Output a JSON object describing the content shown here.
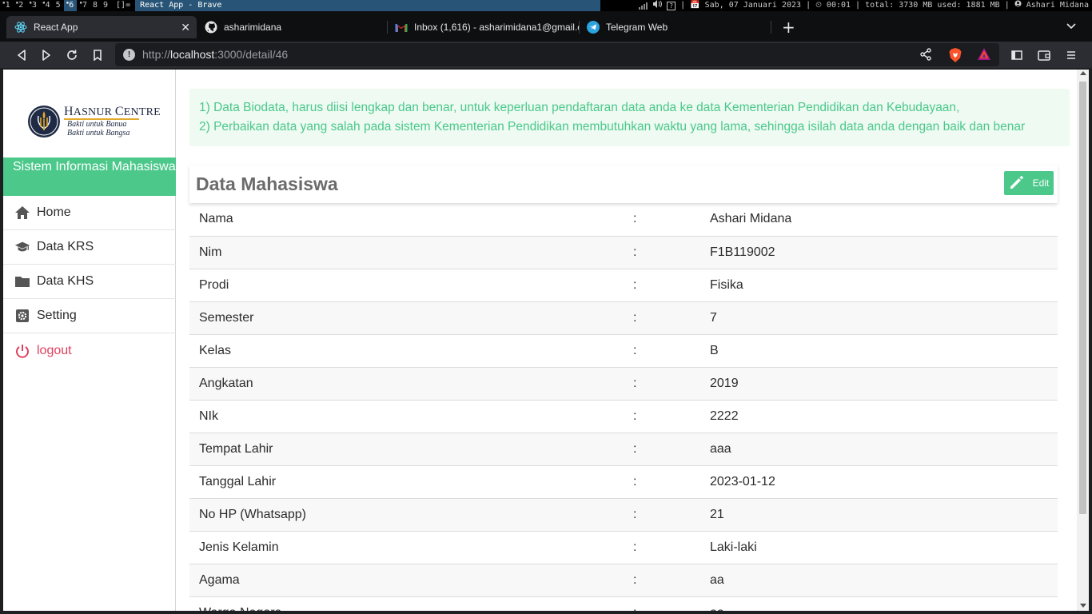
{
  "system_bar": {
    "workspaces": [
      {
        "num": "1",
        "sup": "▪"
      },
      {
        "num": "2",
        "sup": "▪"
      },
      {
        "num": "3",
        "sup": "▪"
      },
      {
        "num": "4",
        "sup": "▪"
      },
      {
        "num": "5",
        "sup": ""
      },
      {
        "num": "6",
        "sup": "▪"
      },
      {
        "num": "7",
        "sup": "▪"
      },
      {
        "num": "8",
        "sup": ""
      },
      {
        "num": "9",
        "sup": ""
      }
    ],
    "active_workspace": "6",
    "layout": "[]=",
    "window_title": "React App - Brave",
    "status": "| 📅 Sab, 07 Januari 2023 | ⏲ 00:01 | total: 3730 MB used: 1881 MB |",
    "user": "Ashari Midana"
  },
  "browser": {
    "tabs": [
      {
        "label": "React App",
        "icon": "react-icon",
        "active": true
      },
      {
        "label": "asharimidana",
        "icon": "github-icon",
        "active": false
      },
      {
        "label": "Inbox (1,616) - asharimidana1@gmail.com",
        "icon": "gmail-icon",
        "active": false
      },
      {
        "label": "Telegram Web",
        "icon": "telegram-icon",
        "active": false
      }
    ],
    "url_scheme": "http://",
    "url_host": "localhost",
    "url_path": ":3000/detail/46",
    "colors": {
      "tab_active": "#2b2d33",
      "tabbar": "#0e0f11"
    }
  },
  "sidebar": {
    "logo": {
      "brand_first": "H",
      "brand_rest": "ASNUR ",
      "brand_first2": "C",
      "brand_rest2": "ENTRE",
      "tag1": "Bakti untuk Banua",
      "tag2": "Bakti untuk Bangsa"
    },
    "header": "Sistem Informasi Mahasiswa",
    "items": [
      {
        "label": "Home",
        "icon": "home-icon"
      },
      {
        "label": "Data KRS",
        "icon": "graduation-cap-icon"
      },
      {
        "label": "Data KHS",
        "icon": "folder-icon"
      },
      {
        "label": "Setting",
        "icon": "gear-icon"
      },
      {
        "label": "logout",
        "icon": "power-icon"
      }
    ],
    "accent": "#4bc88a"
  },
  "alert": {
    "line1": "1) Data Biodata, harus diisi lengkap dan benar, untuk keperluan pendaftaran data anda ke data Kementerian Pendidikan dan Kebudayaan,",
    "line2": "2) Perbaikan data yang salah pada sistem Kementerian Pendidikan membutuhkan waktu yang lama, sehingga isilah data anda dengan baik dan benar"
  },
  "card": {
    "title": "Data Mahasiswa",
    "edit_label": "Edit",
    "rows": [
      {
        "label": "Nama",
        "sep": ":",
        "value": "Ashari Midana"
      },
      {
        "label": "Nim",
        "sep": ":",
        "value": "F1B119002"
      },
      {
        "label": "Prodi",
        "sep": ":",
        "value": "Fisika"
      },
      {
        "label": "Semester",
        "sep": ":",
        "value": "7"
      },
      {
        "label": "Kelas",
        "sep": ":",
        "value": "B"
      },
      {
        "label": "Angkatan",
        "sep": ":",
        "value": "2019"
      },
      {
        "label": "NIk",
        "sep": ":",
        "value": "2222"
      },
      {
        "label": "Tempat Lahir",
        "sep": ":",
        "value": "aaa"
      },
      {
        "label": "Tanggal Lahir",
        "sep": ":",
        "value": "2023-01-12"
      },
      {
        "label": "No HP (Whatsapp)",
        "sep": ":",
        "value": "21"
      },
      {
        "label": "Jenis Kelamin",
        "sep": ":",
        "value": "Laki-laki"
      },
      {
        "label": "Agama",
        "sep": ":",
        "value": "aa"
      },
      {
        "label": "Warga Negara",
        "sep": ":",
        "value": "aa"
      }
    ]
  }
}
